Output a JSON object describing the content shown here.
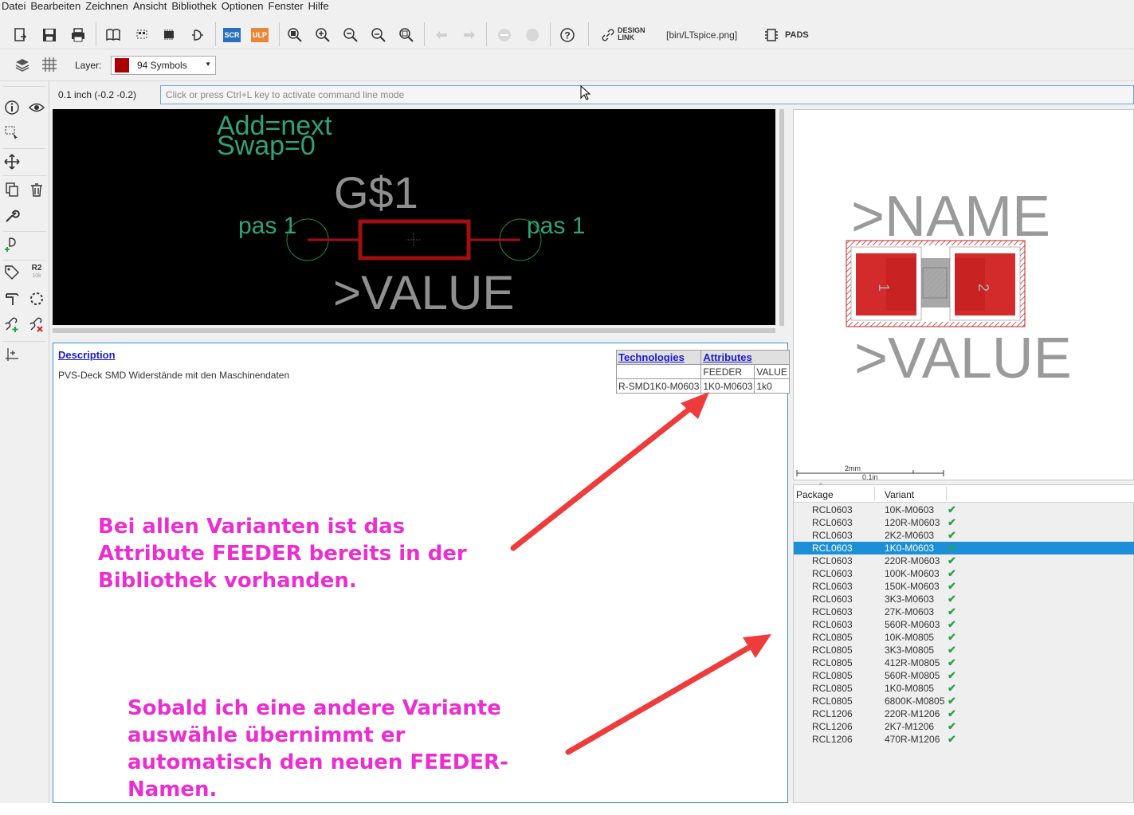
{
  "menu": [
    "Datei",
    "Bearbeiten",
    "Zeichnen",
    "Ansicht",
    "Bibliothek",
    "Optionen",
    "Fenster",
    "Hilfe"
  ],
  "toolbar": {
    "scr_label": "SCR",
    "ulp_label": "ULP",
    "design_link_line1": "DESIGN",
    "design_link_line2": "LINK",
    "file_label": "[bin/LTspice.png]",
    "pads_label": "PADS"
  },
  "layer": {
    "label": "Layer:",
    "value": "94 Symbols",
    "color": "#a00000"
  },
  "left_tools": {
    "r2_label": "R2",
    "r2_sub": "10k"
  },
  "status": {
    "coords": "0.1 inch (-0.2 -0.2)",
    "command_placeholder": "Click or press Ctrl+L key to activate command line mode"
  },
  "symbol": {
    "add_text": "Add=next",
    "swap_text": "Swap=0",
    "name_text": "G$1",
    "pin_left": "pas 1",
    "pin_right": "pas 1",
    "value_text": ">VALUE"
  },
  "description": {
    "title": "Description",
    "text": "PVS-Deck SMD Widerstände mit den Maschinendaten"
  },
  "attr_table": {
    "technologies": "Technologies",
    "attributes": "Attributes",
    "col_feeder": "FEEDER",
    "col_value": "VALUE",
    "tech": "R-SMD1K0-M0603",
    "feeder": "1K0-M0603",
    "value": "1k0"
  },
  "notes": {
    "note1_l1": "Bei allen Varianten ist das",
    "note1_l2": "Attribute FEEDER bereits in der",
    "note1_l3": "Bibliothek vorhanden.",
    "note2_l1": "Sobald ich eine andere Variante",
    "note2_l2": "auswähle übernimmt er",
    "note2_l3": "automatisch den neuen FEEDER-",
    "note2_l4": "Namen."
  },
  "preview": {
    "name_text": ">NAME",
    "value_text": ">VALUE",
    "pad1": "1",
    "pad2": "2",
    "scale_mm": "2mm",
    "scale_in": "0.1in"
  },
  "list": {
    "col_package": "Package",
    "col_variant": "Variant",
    "selected_index": 3,
    "rows": [
      {
        "package": "RCL0603",
        "variant": "10K-M0603"
      },
      {
        "package": "RCL0603",
        "variant": "120R-M0603"
      },
      {
        "package": "RCL0603",
        "variant": "2K2-M0603"
      },
      {
        "package": "RCL0603",
        "variant": "1K0-M0603"
      },
      {
        "package": "RCL0603",
        "variant": "220R-M0603"
      },
      {
        "package": "RCL0603",
        "variant": "100K-M0603"
      },
      {
        "package": "RCL0603",
        "variant": "150K-M0603"
      },
      {
        "package": "RCL0603",
        "variant": "3K3-M0603"
      },
      {
        "package": "RCL0603",
        "variant": "27K-M0603"
      },
      {
        "package": "RCL0603",
        "variant": "560R-M0603"
      },
      {
        "package": "RCL0805",
        "variant": "10K-M0805"
      },
      {
        "package": "RCL0805",
        "variant": "3K3-M0805"
      },
      {
        "package": "RCL0805",
        "variant": "412R-M0805"
      },
      {
        "package": "RCL0805",
        "variant": "560R-M0805"
      },
      {
        "package": "RCL0805",
        "variant": "1K0-M0805"
      },
      {
        "package": "RCL0805",
        "variant": "6800K-M0805"
      },
      {
        "package": "RCL1206",
        "variant": "220R-M1206"
      },
      {
        "package": "RCL1206",
        "variant": "2K7-M1206"
      },
      {
        "package": "RCL1206",
        "variant": "470R-M1206"
      }
    ]
  },
  "colors": {
    "annotation": "#ea2ed0",
    "arrow": "#ee3b3b",
    "selection": "#1c8fd8",
    "symbol_green": "#2fa37a",
    "symbol_red": "#a01010"
  }
}
